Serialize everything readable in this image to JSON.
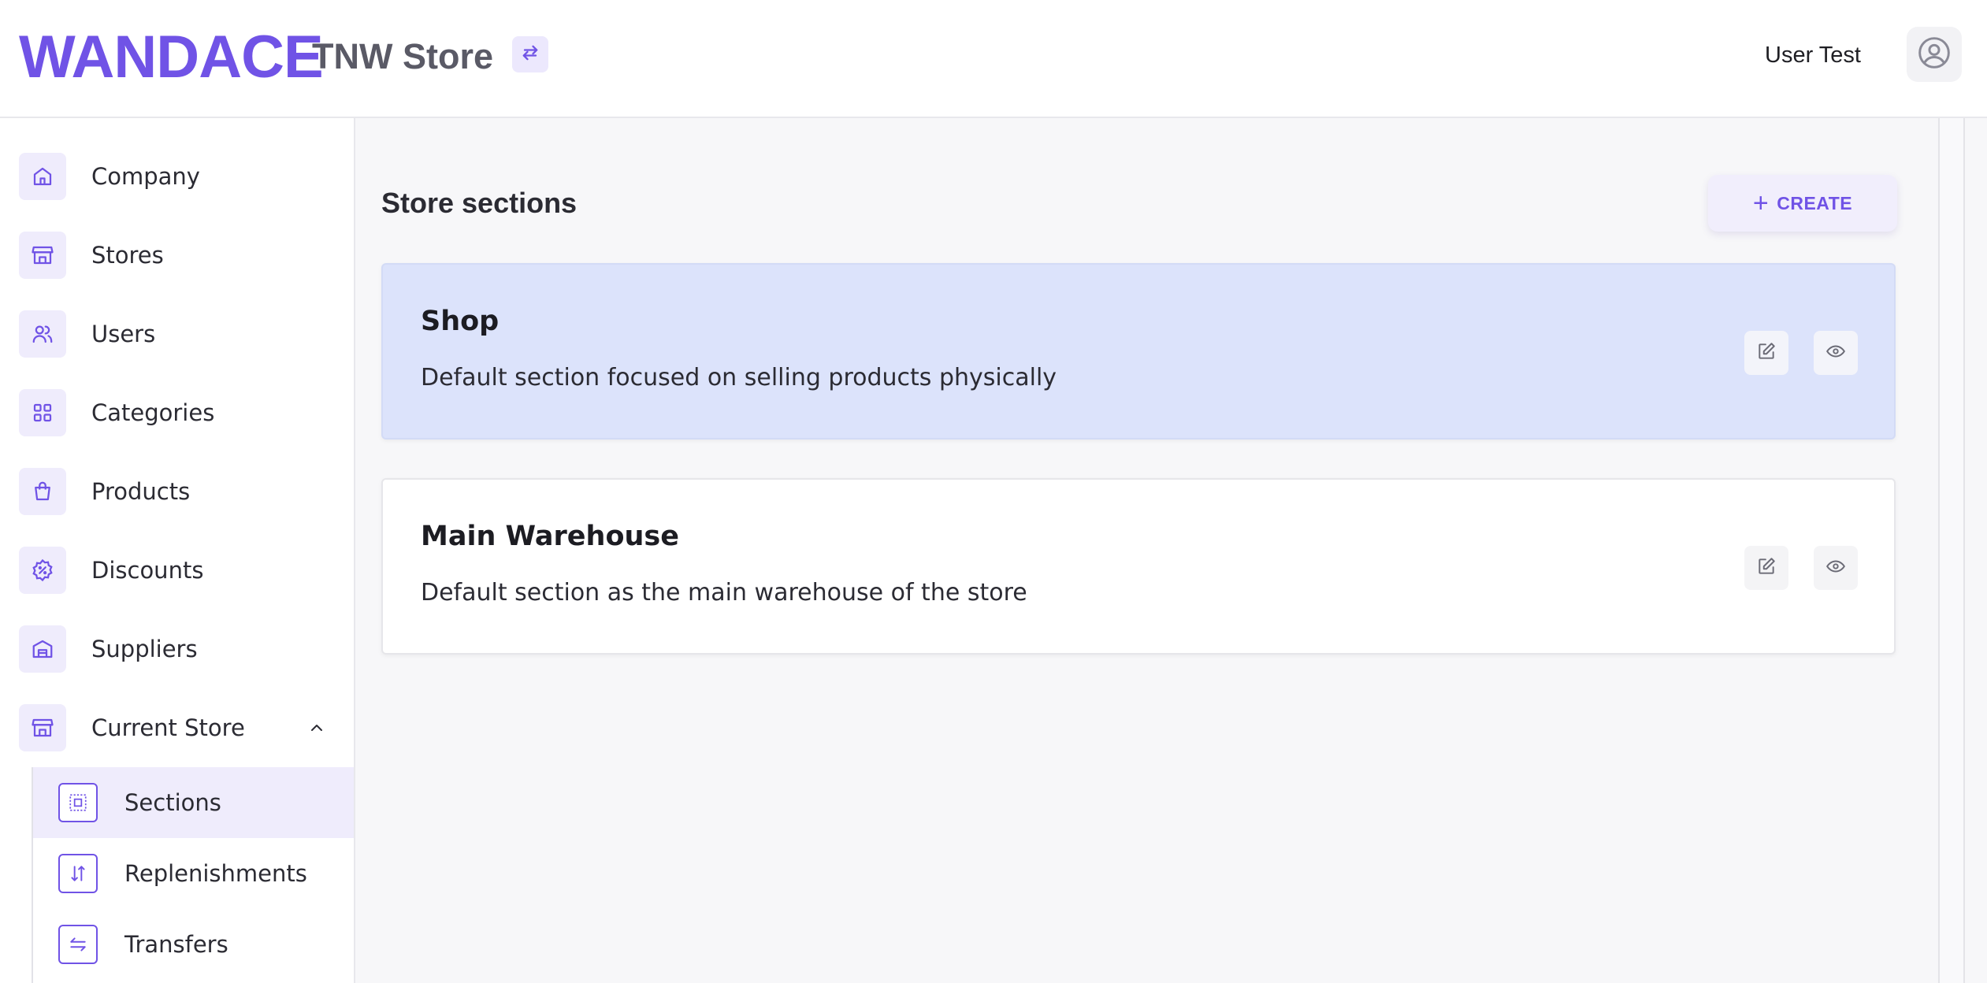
{
  "header": {
    "logo": "WANDACE",
    "store_name": "TNW Store",
    "user_name": "User Test",
    "switch_icon": "swap-arrows-icon",
    "avatar_icon": "user-circle-icon"
  },
  "sidebar": {
    "items": [
      {
        "label": "Company",
        "icon": "home-icon"
      },
      {
        "label": "Stores",
        "icon": "store-icon"
      },
      {
        "label": "Users",
        "icon": "users-icon"
      },
      {
        "label": "Categories",
        "icon": "grid-icon"
      },
      {
        "label": "Products",
        "icon": "shopping-bag-icon"
      },
      {
        "label": "Discounts",
        "icon": "discount-badge-icon"
      },
      {
        "label": "Suppliers",
        "icon": "warehouse-icon"
      },
      {
        "label": "Current Store",
        "icon": "store-icon"
      }
    ],
    "sub_items": [
      {
        "label": "Sections",
        "icon": "section-icon",
        "active": true
      },
      {
        "label": "Replenishments",
        "icon": "replenish-icon",
        "active": false
      },
      {
        "label": "Transfers",
        "icon": "transfer-icon",
        "active": false
      }
    ]
  },
  "main": {
    "title": "Store sections",
    "create_label": "CREATE",
    "sections": [
      {
        "name": "Shop",
        "description": "Default section focused on selling products physically",
        "highlighted": true
      },
      {
        "name": "Main Warehouse",
        "description": "Default section as the main warehouse of the store",
        "highlighted": false
      }
    ]
  },
  "colors": {
    "accent": "#7053e6",
    "highlight_card": "#dce3fb",
    "icon_bg": "#efecfc"
  }
}
